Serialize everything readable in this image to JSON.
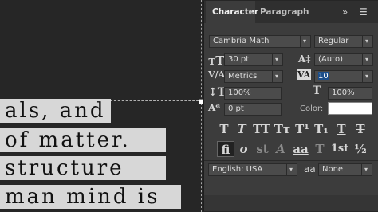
{
  "canvas": {
    "text_lines": [
      "als, and",
      "of matter.",
      "structure",
      "man mind is"
    ]
  },
  "panel": {
    "tabs": [
      {
        "label": "Character"
      },
      {
        "label": "Paragraph"
      }
    ],
    "menu_icons": [
      "collapse-icon",
      "panel-menu-icon"
    ],
    "font_family": "Cambria Math",
    "font_style": "Regular",
    "font_size": "30 pt",
    "leading": "(Auto)",
    "kerning": "Metrics",
    "tracking": "10",
    "vertical_scale": "100%",
    "horizontal_scale": "100%",
    "baseline_shift": "0 pt",
    "color_label": "Color:",
    "color_value": "#ffffff",
    "type_buttons_row1": [
      "T",
      "T",
      "TT",
      "Tт",
      "T¹",
      "T₁",
      "T",
      "T"
    ],
    "type_buttons_row2": [
      "fi",
      "σ",
      "st",
      "A",
      "aa",
      "T",
      "1st",
      "½"
    ],
    "language": "English: USA",
    "aa_label": "aa",
    "anti_alias": "None"
  }
}
